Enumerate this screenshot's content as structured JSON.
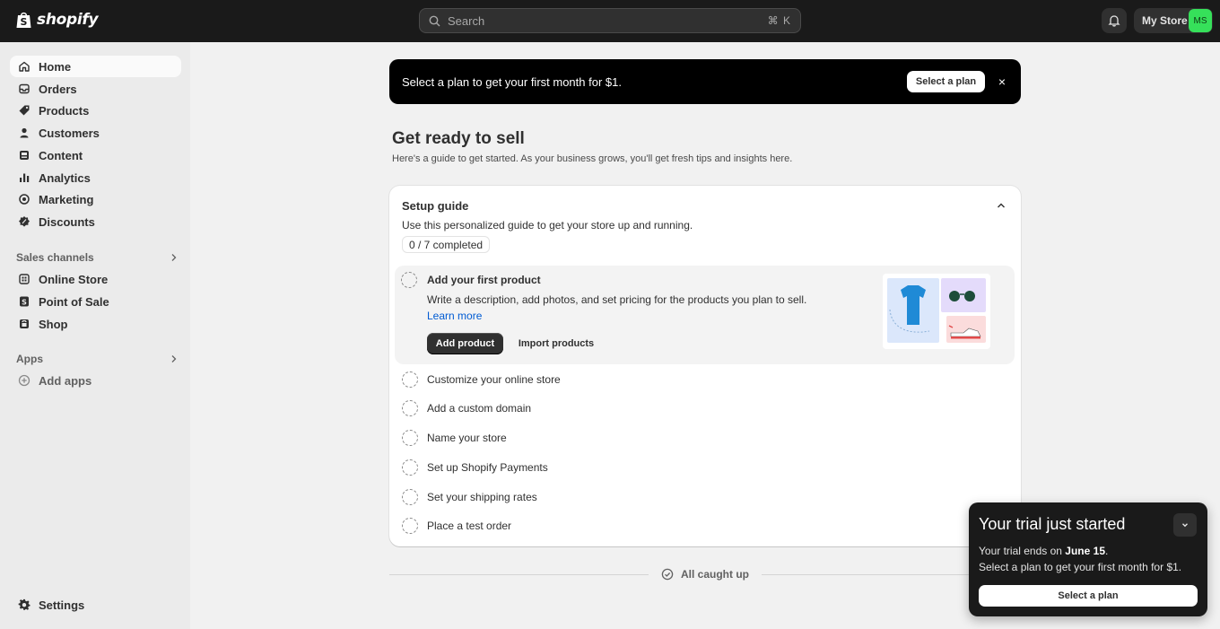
{
  "topbar": {
    "logo_text": "shopify",
    "search_placeholder": "Search",
    "search_shortcut": "⌘ K",
    "store_name": "My Store",
    "avatar_initials": "MS",
    "avatar_color": "#36e05a"
  },
  "sidebar": {
    "items": [
      {
        "label": "Home",
        "icon": "home-icon",
        "active": true
      },
      {
        "label": "Orders",
        "icon": "inbox-icon"
      },
      {
        "label": "Products",
        "icon": "tag-icon"
      },
      {
        "label": "Customers",
        "icon": "person-icon"
      },
      {
        "label": "Content",
        "icon": "content-icon"
      },
      {
        "label": "Analytics",
        "icon": "bar-chart-icon"
      },
      {
        "label": "Marketing",
        "icon": "target-icon"
      },
      {
        "label": "Discounts",
        "icon": "discount-icon"
      }
    ],
    "sales_channels_label": "Sales channels",
    "channels": [
      {
        "label": "Online Store",
        "icon": "store-icon"
      },
      {
        "label": "Point of Sale",
        "icon": "pos-icon"
      },
      {
        "label": "Shop",
        "icon": "shop-bag-icon"
      }
    ],
    "apps_label": "Apps",
    "add_apps_label": "Add apps",
    "settings_label": "Settings"
  },
  "banner": {
    "text": "Select a plan to get your first month for $1.",
    "button_label": "Select a plan",
    "close_glyph": "×"
  },
  "page": {
    "title": "Get ready to sell",
    "subtitle": "Here's a guide to get started. As your business grows, you'll get fresh tips and insights here."
  },
  "setup_guide": {
    "title": "Setup guide",
    "description": "Use this personalized guide to get your store up and running.",
    "progress": "0 / 7 completed",
    "active_step": {
      "title": "Add your first product",
      "body": "Write a description, add photos, and set pricing for the products you plan to sell.",
      "link": "Learn more",
      "primary_button": "Add product",
      "secondary_button": "Import products"
    },
    "steps": [
      "Customize your online store",
      "Add a custom domain",
      "Name your store",
      "Set up Shopify Payments",
      "Set your shipping rates",
      "Place a test order"
    ]
  },
  "footer_status": "All caught up",
  "trial": {
    "title": "Your trial just started",
    "ends_prefix": "Your trial ends on ",
    "ends_date": "June 15",
    "ends_suffix": ".",
    "line2": "Select a plan to get your first month for $1.",
    "button_label": "Select a plan"
  }
}
